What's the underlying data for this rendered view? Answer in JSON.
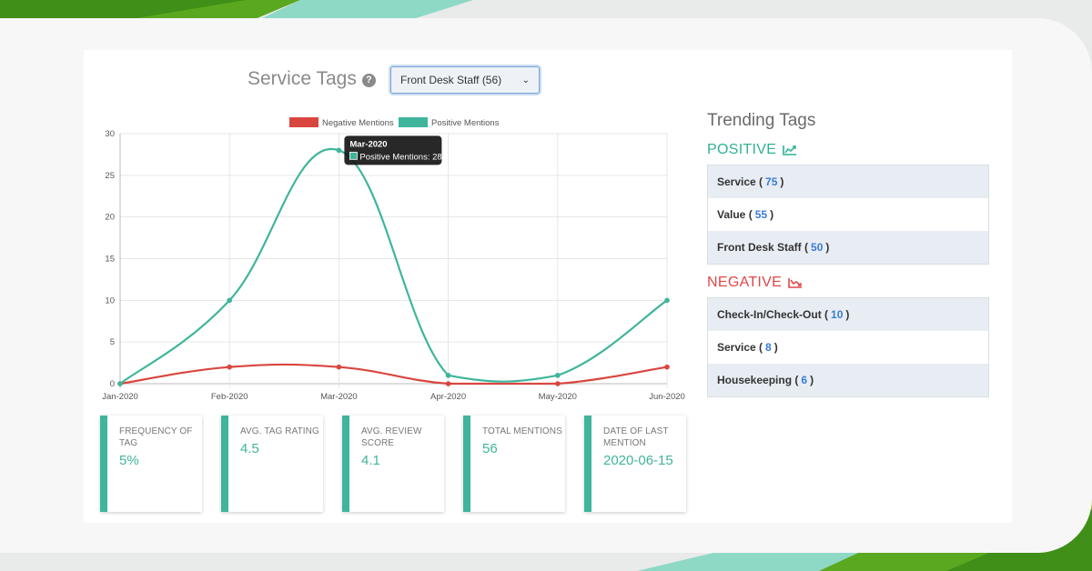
{
  "colors": {
    "positive": "#3fb59b",
    "negative": "#d9463f",
    "accent_blue": "#3a7bd5",
    "brand_green": "#5aa81f",
    "brand_teal": "#8ed8c6"
  },
  "header": {
    "title": "Service Tags",
    "help_icon": "question-circle-icon",
    "select": {
      "selected": "Front Desk Staff (56)",
      "icon": "chevron-down-icon"
    }
  },
  "chart_data": {
    "type": "line",
    "categories": [
      "Jan-2020",
      "Feb-2020",
      "Mar-2020",
      "Apr-2020",
      "May-2020",
      "Jun-2020"
    ],
    "series": [
      {
        "name": "Negative Mentions",
        "color": "#d9463f",
        "values": [
          0,
          2,
          2,
          0,
          0,
          2
        ]
      },
      {
        "name": "Positive Mentions",
        "color": "#3fb59b",
        "values": [
          0,
          10,
          28,
          1,
          1,
          10
        ]
      }
    ],
    "yticks": [
      "0",
      "5",
      "10",
      "15",
      "20",
      "25",
      "30"
    ],
    "ylim": [
      0,
      30
    ],
    "grid": true,
    "legend": "top-center",
    "tooltip": {
      "title": "Mar-2020",
      "text": "Positive Mentions: 28",
      "category_index": 2,
      "series_index": 1
    }
  },
  "stats": [
    {
      "label": "FREQUENCY OF TAG",
      "value": "5%"
    },
    {
      "label": "AVG. TAG RATING",
      "value": "4.5"
    },
    {
      "label": "AVG. REVIEW SCORE",
      "value": "4.1"
    },
    {
      "label": "TOTAL MENTIONS",
      "value": "56"
    },
    {
      "label": "DATE OF LAST MENTION",
      "value": "2020-06-15"
    }
  ],
  "trending": {
    "title": "Trending Tags",
    "positive": {
      "heading": "POSITIVE",
      "icon": "trend-up-icon",
      "items": [
        {
          "name": "Service",
          "count": "75"
        },
        {
          "name": "Value",
          "count": "55"
        },
        {
          "name": "Front Desk Staff",
          "count": "50"
        }
      ]
    },
    "negative": {
      "heading": "NEGATIVE",
      "icon": "trend-down-icon",
      "items": [
        {
          "name": "Check-In/Check-Out",
          "count": "10"
        },
        {
          "name": "Service",
          "count": "8"
        },
        {
          "name": "Housekeeping",
          "count": "6"
        }
      ]
    }
  }
}
